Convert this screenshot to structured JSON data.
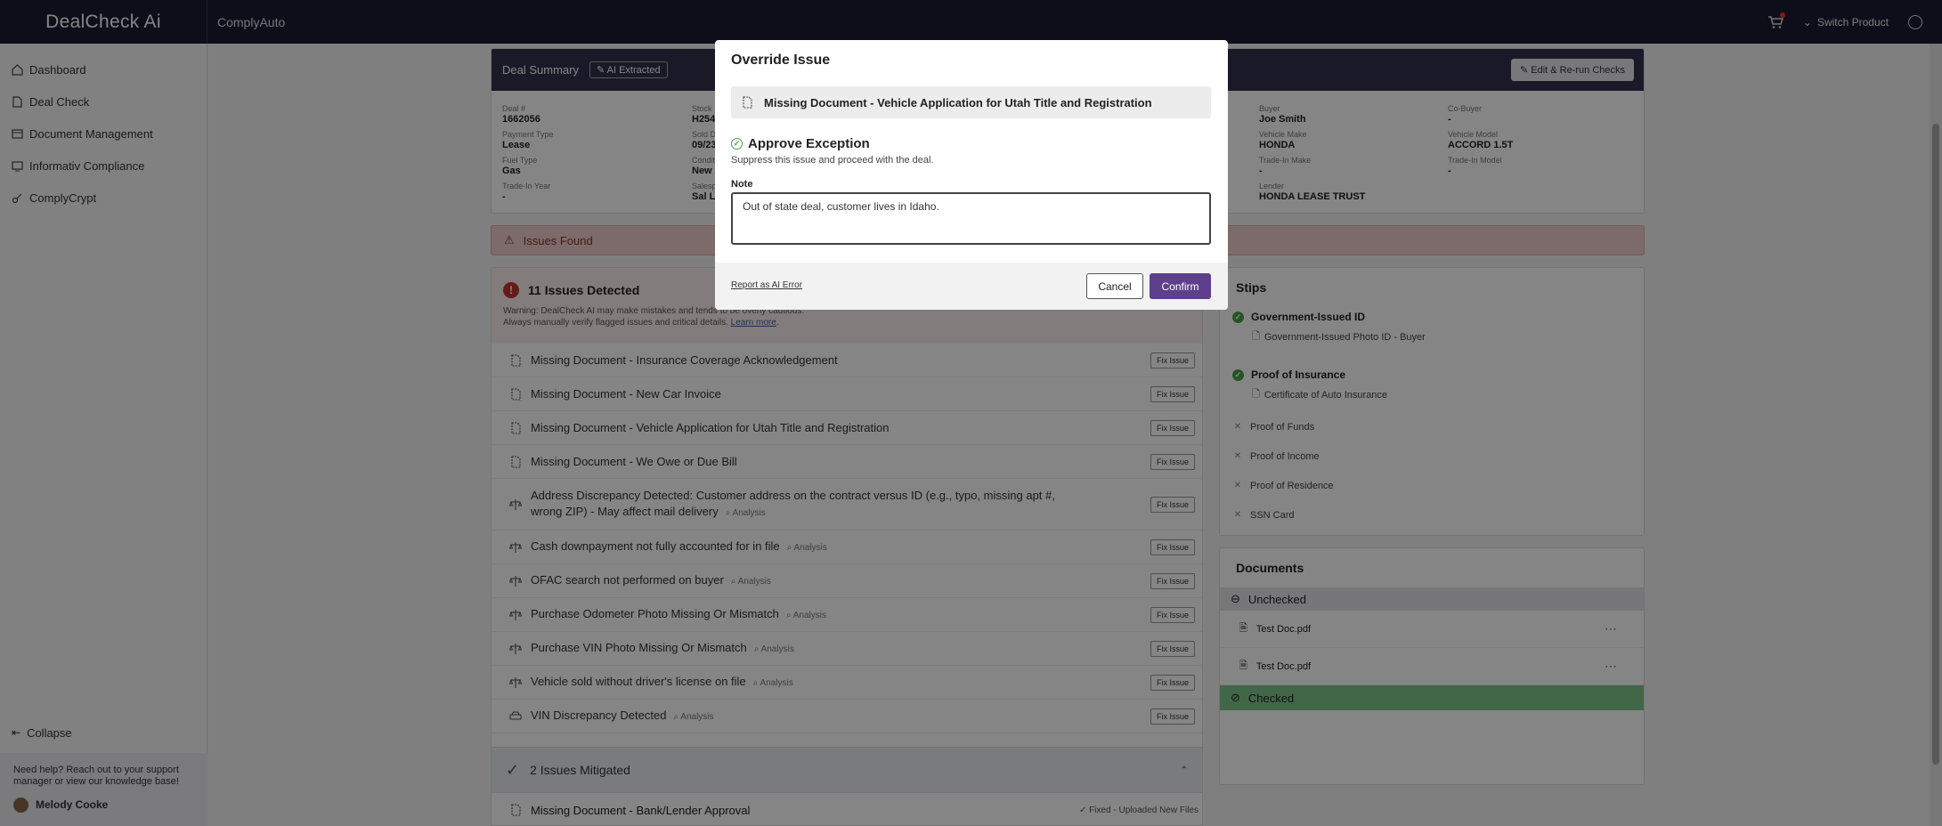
{
  "topbar": {
    "brand": "DealCheck Ai",
    "company": "ComplyAuto",
    "switch_label": "Switch Product"
  },
  "sidebar": {
    "items": [
      {
        "label": "Dashboard",
        "icon": "home-icon"
      },
      {
        "label": "Deal Check",
        "icon": "document-icon"
      },
      {
        "label": "Document Management",
        "icon": "folder-icon"
      },
      {
        "label": "Informativ Compliance",
        "icon": "monitor-icon"
      },
      {
        "label": "ComplyCrypt",
        "icon": "key-icon"
      }
    ],
    "collapse": "Collapse",
    "help_text": "Need help? Reach out to your support manager or view our knowledge base!",
    "user": "Melody Cooke"
  },
  "deal_summary": {
    "title": "Deal Summary",
    "ai_tag": "AI Extracted",
    "edit_button": "Edit & Re-run Checks",
    "col1": [
      {
        "label": "Deal #",
        "value": "1662056"
      },
      {
        "label": "Payment Type",
        "value": "Lease"
      },
      {
        "label": "Fuel Type",
        "value": "Gas"
      },
      {
        "label": "Trade-In Year",
        "value": "-"
      }
    ],
    "col2": [
      {
        "label": "Stock",
        "value": "H254"
      },
      {
        "label": "Sold D",
        "value": "09/23"
      },
      {
        "label": "Condit",
        "value": "New"
      },
      {
        "label": "Salesp",
        "value": "Sal La"
      }
    ],
    "col3": [
      {
        "label": "Buyer",
        "value": "Joe Smith"
      },
      {
        "label": "Vehicle Make",
        "value": "HONDA"
      },
      {
        "label": "Trade-In Make",
        "value": "-"
      },
      {
        "label": "Lender",
        "value": "HONDA LEASE TRUST"
      }
    ],
    "col4": [
      {
        "label": "Co-Buyer",
        "value": "-"
      },
      {
        "label": "Vehicle Model",
        "value": "ACCORD 1.5T"
      },
      {
        "label": "Trade-In Model",
        "value": "-"
      }
    ]
  },
  "issues_found": "Issues Found",
  "issues": {
    "detected_title": "11 Issues Detected",
    "warning_line1": "Warning: DealCheck AI may make mistakes and tends to be overly cautious.",
    "warning_line2": "Always manually verify flagged issues and critical details.",
    "learn_more": "Learn more",
    "fix_label": "Fix Issue",
    "analysis_label": "Analysis",
    "items": [
      {
        "text": "Missing Document - Insurance Coverage Acknowledgement",
        "icon": "missing-document-icon",
        "analysis": false
      },
      {
        "text": "Missing Document - New Car Invoice",
        "icon": "missing-document-icon",
        "analysis": false
      },
      {
        "text": "Missing Document - Vehicle Application for Utah Title and Registration",
        "icon": "missing-document-icon",
        "analysis": false
      },
      {
        "text": "Missing Document - We Owe or Due Bill",
        "icon": "missing-document-icon",
        "analysis": false
      },
      {
        "text": "Address Discrepancy Detected: Customer address on the contract versus ID (e.g., typo, missing apt #, wrong ZIP) - May affect mail delivery",
        "icon": "scale-icon",
        "analysis": true
      },
      {
        "text": "Cash downpayment not fully accounted for in file",
        "icon": "scale-icon",
        "analysis": true
      },
      {
        "text": "OFAC search not performed on buyer",
        "icon": "scale-icon",
        "analysis": true
      },
      {
        "text": "Purchase Odometer Photo Missing Or Mismatch",
        "icon": "scale-icon",
        "analysis": true
      },
      {
        "text": "Purchase VIN Photo Missing Or Mismatch",
        "icon": "scale-icon",
        "analysis": true
      },
      {
        "text": "Vehicle sold without driver's license on file",
        "icon": "scale-icon",
        "analysis": true
      },
      {
        "text": "VIN Discrepancy Detected",
        "icon": "car-icon",
        "analysis": true
      }
    ],
    "mitigated_title": "2 Issues Mitigated",
    "mitigated_item": "Missing Document - Bank/Lender Approval",
    "mitigated_status": "Fixed - Uploaded New Files"
  },
  "stips": {
    "title": "Stips",
    "approved": [
      {
        "label": "Government-Issued ID",
        "doc": "Government-Issued Photo ID - Buyer"
      },
      {
        "label": "Proof of Insurance",
        "doc": "Certificate of Auto Insurance"
      }
    ],
    "missing": [
      "Proof of Funds",
      "Proof of Income",
      "Proof of Residence",
      "SSN Card"
    ]
  },
  "documents": {
    "title": "Documents",
    "unchecked_label": "Unchecked",
    "files": [
      "Test Doc.pdf",
      "Test Doc.pdf"
    ],
    "checked_label": "Checked"
  },
  "modal": {
    "title": "Override Issue",
    "issue": "Missing Document - Vehicle Application for Utah Title and Registration",
    "approve_title": "Approve Exception",
    "approve_desc": "Suppress this issue and proceed with the deal.",
    "note_label": "Note",
    "note_value": "Out of state deal, customer lives in Idaho.",
    "report_link": "Report as AI Error",
    "cancel": "Cancel",
    "confirm": "Confirm"
  },
  "colors": {
    "topbar": "#1c1a33",
    "accent": "#5e3f8c",
    "danger": "#c0392b",
    "success": "#47a447"
  }
}
